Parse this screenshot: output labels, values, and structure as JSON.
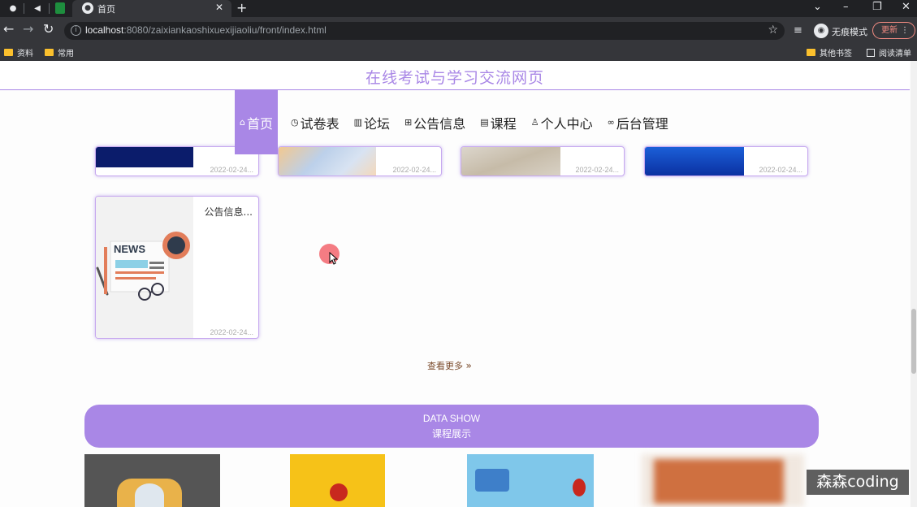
{
  "browser": {
    "tab_title": "首页",
    "url_host": "localhost",
    "url_rest": ":8080/zaixiankaoshixuexijiaoliu/front/index.html",
    "incognito_label": "无痕模式",
    "update_label": "更新",
    "bookmarks": [
      {
        "label": "资料"
      },
      {
        "label": "常用"
      },
      {
        "label": "其他书签"
      },
      {
        "label": "阅读清单"
      }
    ]
  },
  "site": {
    "title": "在线考试与学习交流网页",
    "menu": [
      {
        "label": "首页",
        "icon": "home-icon"
      },
      {
        "label": "试卷表",
        "icon": "clock-icon"
      },
      {
        "label": "论坛",
        "icon": "columns-icon"
      },
      {
        "label": "公告信息",
        "icon": "grid-icon"
      },
      {
        "label": "课程",
        "icon": "doc-icon"
      },
      {
        "label": "个人中心",
        "icon": "user-icon"
      },
      {
        "label": "后台管理",
        "icon": "link-icon"
      }
    ]
  },
  "news_cards": [
    {
      "date": "2022-02-24..."
    },
    {
      "date": "2022-02-24..."
    },
    {
      "date": "2022-02-24..."
    },
    {
      "date": "2022-02-24..."
    },
    {
      "title": "公告信息...",
      "date": "2022-02-24...",
      "image_text": "NEWS"
    }
  ],
  "more_label": "查看更多",
  "banner": {
    "title_en": "DATA SHOW",
    "title_cn": "课程展示"
  },
  "watermark": "森森coding",
  "colors": {
    "accent": "#a987e6",
    "browser_dark": "#35363a"
  }
}
